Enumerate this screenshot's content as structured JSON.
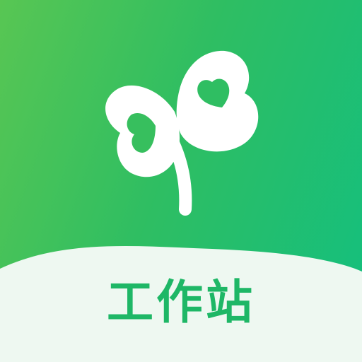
{
  "app": {
    "label": "工作站",
    "icon_name": "clover-leaf-icon"
  },
  "colors": {
    "gradient_start": "#58c653",
    "gradient_mid": "#2fbe62",
    "gradient_end": "#13bf7f",
    "band": "#eef8f1",
    "label": "#1eb766",
    "logo": "#ffffff"
  }
}
